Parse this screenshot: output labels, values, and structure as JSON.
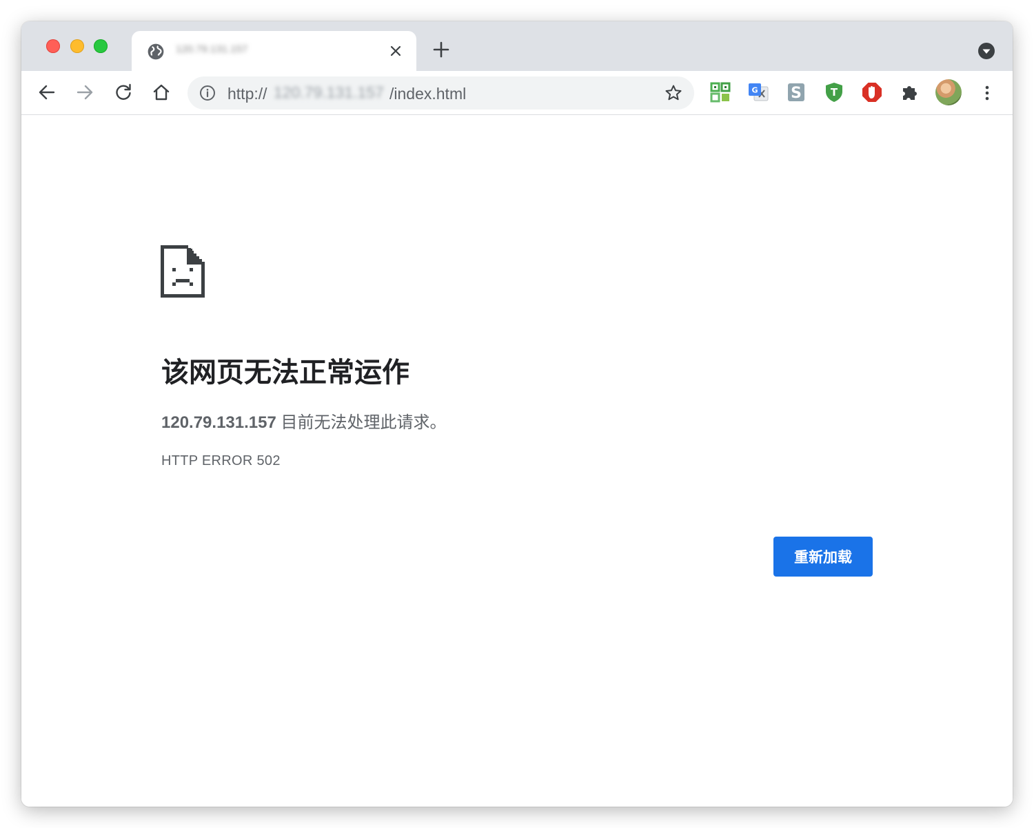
{
  "browser": {
    "tab": {
      "title": "120.79.131.157",
      "close_icon": "close-icon",
      "favicon": "globe-icon"
    },
    "toolbar": {
      "url_scheme": "http://",
      "url_host": "120.79.131.157",
      "url_path": "/index.html",
      "icons": [
        "back-arrow-icon",
        "forward-arrow-icon",
        "reload-icon",
        "home-icon",
        "site-info-icon",
        "bookmark-star-icon"
      ],
      "extensions": [
        "qr-code-extension-icon",
        "google-translate-extension-icon",
        "s-extension-icon",
        "tampermonkey-extension-icon",
        "adblock-extension-icon",
        "puzzle-extensions-icon"
      ],
      "menu_icon": "more-vert-icon"
    }
  },
  "page": {
    "heading": "该网页无法正常运作",
    "host": "120.79.131.157",
    "message": " 目前无法处理此请求。",
    "error_code": "HTTP ERROR 502",
    "reload_label": "重新加载",
    "accent_color": "#1a73e8"
  }
}
